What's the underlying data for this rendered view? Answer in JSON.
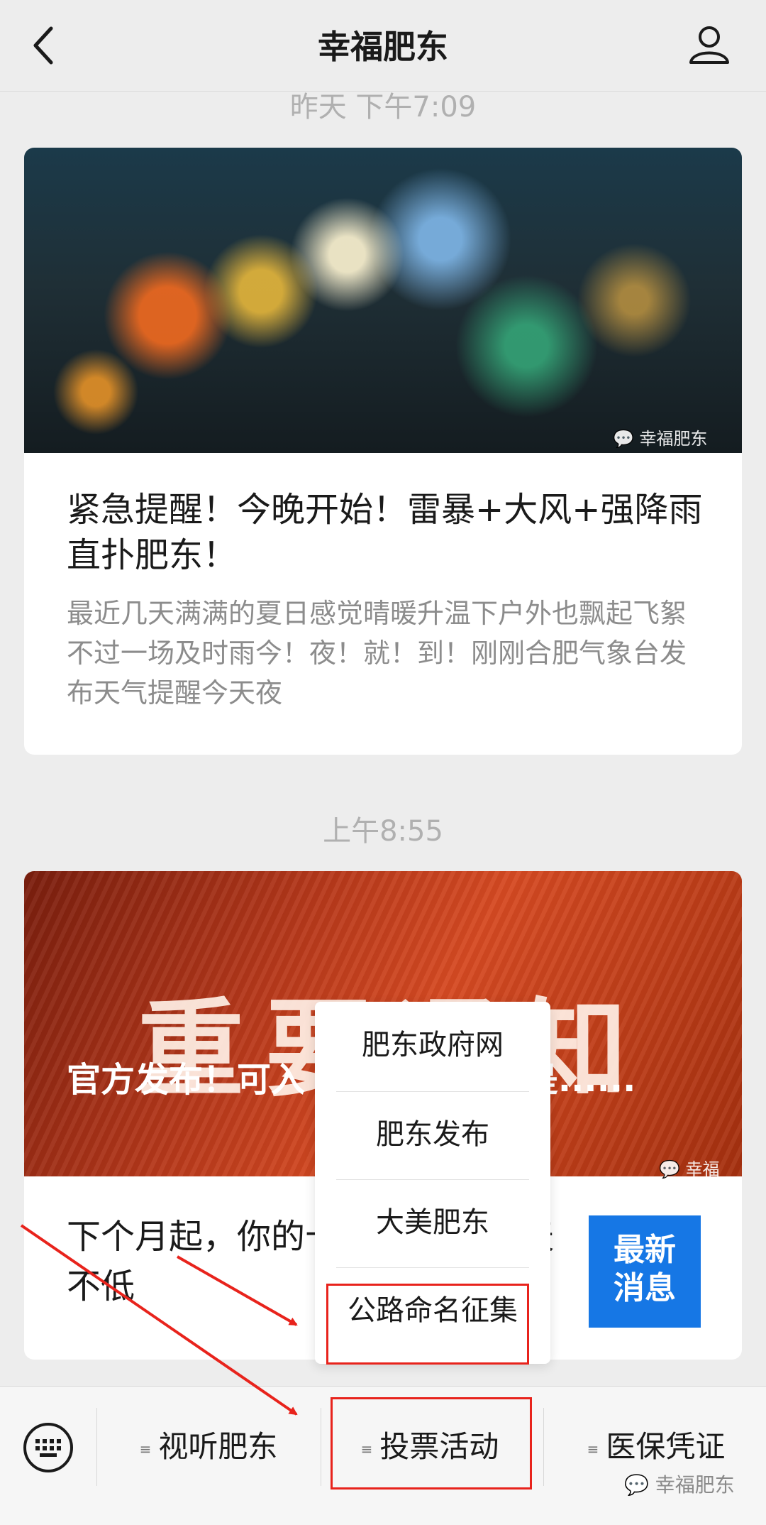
{
  "header": {
    "title": "幸福肥东"
  },
  "feed": [
    {
      "timestamp": "昨天 下午7:09",
      "image_watermark": "幸福肥东",
      "title": "紧急提醒！今晚开始！雷暴+大风+强降雨直扑肥东！",
      "digest": "最近几天满满的夏日感觉晴暖升温下户外也飘起飞絮不过一场及时雨今！夜！就！到！刚刚合肥气象台发布天气提醒今天夜"
    },
    {
      "timestamp": "上午8:55",
      "image_text": "重要通知",
      "image_caption": "官方发布！可入 000人！要求是......",
      "image_watermark": "幸福",
      "sub_title": "下个月起，你的十 钱！每人每天不低",
      "thumb_text": [
        "最新",
        "消息"
      ]
    }
  ],
  "popup_menu": [
    "肥东政府网",
    "肥东发布",
    "大美肥东",
    "公路命名征集"
  ],
  "bottom_menu": [
    {
      "label": "视听肥东"
    },
    {
      "label": "投票活动"
    },
    {
      "label": "医保凭证"
    }
  ],
  "watermark": "幸福肥东",
  "colors": {
    "highlight": "#e8231c",
    "thumb_bg": "#1677e5"
  }
}
